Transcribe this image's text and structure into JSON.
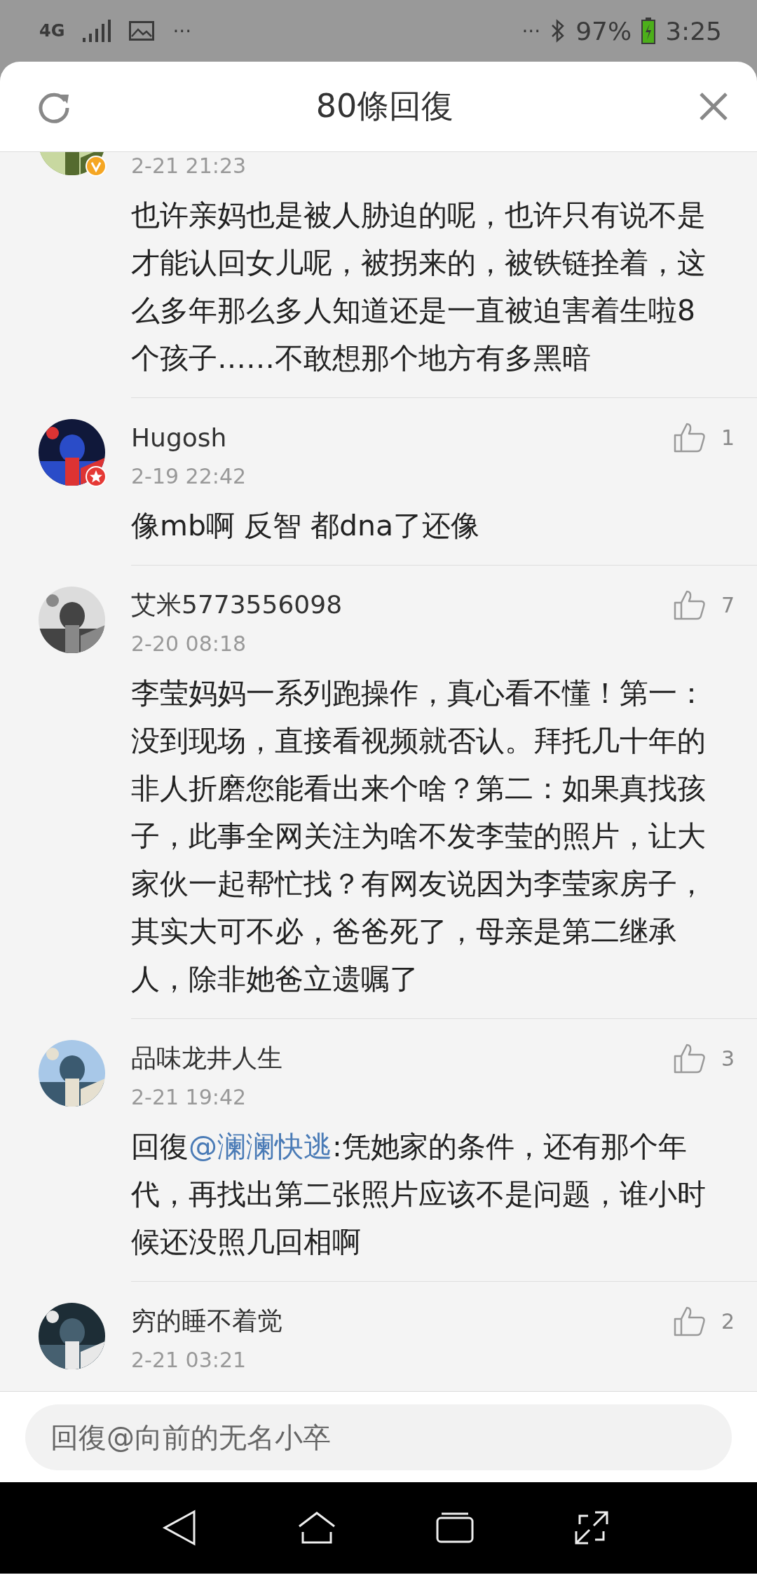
{
  "status_bar": {
    "network": "4G",
    "more_left": "···",
    "more_right": "···",
    "battery": "97%",
    "time": "3:25"
  },
  "header": {
    "title": "80條回復"
  },
  "comments": [
    {
      "verified_badge": true,
      "star_badge": false,
      "time": "2-21 21:23",
      "text": "也许亲妈也是被人胁迫的呢，也许只有说不是才能认回女儿呢，被拐来的，被铁链拴着，这么多年那么多人知道还是一直被迫害着生啦8个孩子……不敢想那个地方有多黑暗"
    },
    {
      "verified_badge": false,
      "star_badge": true,
      "name": "Hugosh",
      "time": "2-19 22:42",
      "likes": "1",
      "text": "像mb啊 反智 都dna了还像"
    },
    {
      "verified_badge": false,
      "star_badge": false,
      "name": "艾米5773556098",
      "time": "2-20 08:18",
      "likes": "7",
      "text": "李莹妈妈一系列跑操作，真心看不懂！第一：没到现场，直接看视频就否认。拜托几十年的非人折磨您能看出来个啥？第二：如果真找孩子，此事全网关注为啥不发李莹的照片，让大家伙一起帮忙找？有网友说因为李莹家房子，其实大可不必，爸爸死了，母亲是第二继承人，除非她爸立遗嘱了"
    },
    {
      "verified_badge": false,
      "star_badge": false,
      "name": "品味龙井人生",
      "time": "2-21 19:42",
      "likes": "3",
      "reply_prefix": "回復",
      "mention": "@澜澜快逃",
      "text": ":凭她家的条件，还有那个年代，再找出第二张照片应该不是问题，谁小时候还没照几回相啊"
    },
    {
      "verified_badge": false,
      "star_badge": false,
      "name": "穷的睡不着觉",
      "time": "2-21 03:21",
      "likes": "2"
    }
  ],
  "reply_field": {
    "placeholder": "回復@向前的无名小卒"
  }
}
